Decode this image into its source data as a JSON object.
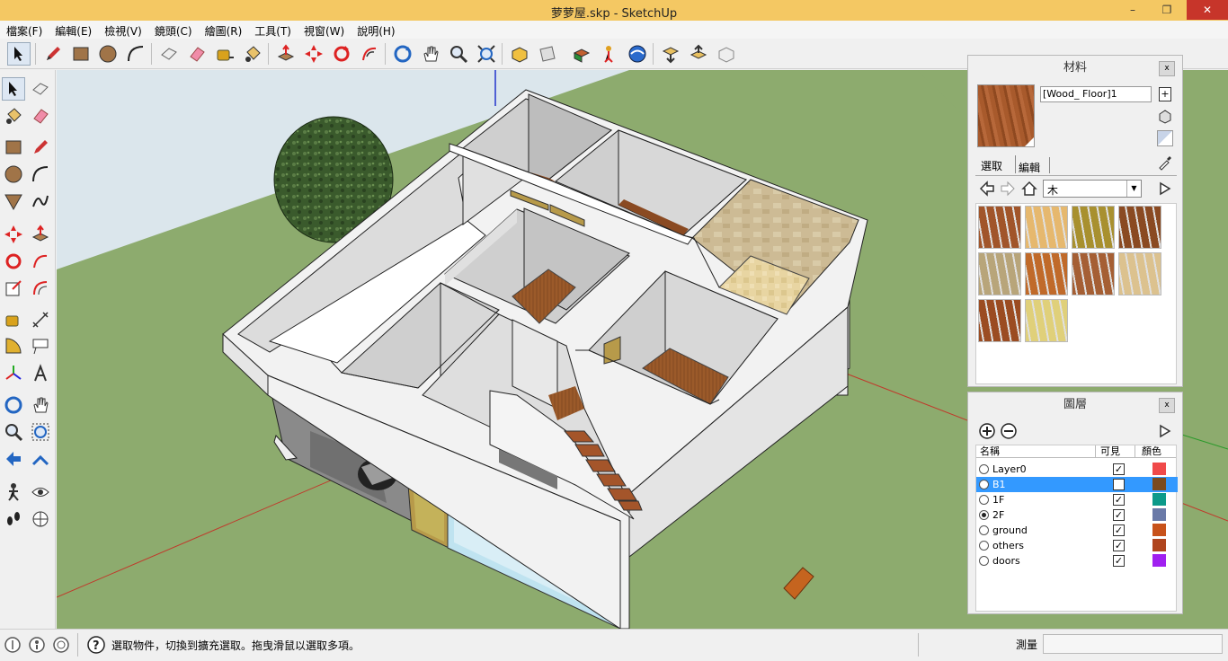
{
  "window": {
    "title": "萝萝屋.skp - SketchUp",
    "minimize": "–",
    "maximize": "❐",
    "close": "✕"
  },
  "menu": [
    "檔案(F)",
    "編輯(E)",
    "檢視(V)",
    "鏡頭(C)",
    "繪圖(R)",
    "工具(T)",
    "視窗(W)",
    "說明(H)"
  ],
  "materials": {
    "title": "材料",
    "close": "x",
    "name_value": "[Wood_ Floor]1",
    "tab_select": "選取",
    "tab_edit": "編輯",
    "collection": "木",
    "swatch_colors": [
      "#a1552a",
      "#e6b86e",
      "#a8902f",
      "#8a4a22",
      "#b8a57a",
      "#c06a2a",
      "#a55f34",
      "#dcc28f",
      "#9b4c22",
      "#e0d07a"
    ]
  },
  "layers": {
    "title": "圖層",
    "close": "x",
    "col_name": "名稱",
    "col_visible": "可見",
    "col_color": "顏色",
    "rows": [
      {
        "name": "Layer0",
        "visible": true,
        "active": false,
        "color": "#f04a4a"
      },
      {
        "name": "B1",
        "visible": false,
        "active": false,
        "color": "#7a4a1f",
        "selected": true
      },
      {
        "name": "1F",
        "visible": true,
        "active": false,
        "color": "#0c9a8a"
      },
      {
        "name": "2F",
        "visible": true,
        "active": true,
        "color": "#6a7aa8"
      },
      {
        "name": "ground",
        "visible": true,
        "active": false,
        "color": "#c8521a"
      },
      {
        "name": "others",
        "visible": true,
        "active": false,
        "color": "#b0451e"
      },
      {
        "name": "doors",
        "visible": true,
        "active": false,
        "color": "#a020f0"
      }
    ]
  },
  "status": {
    "hint": "選取物件，切換到擴充選取。拖曳滑鼠以選取多項。",
    "measure_label": "測量",
    "measure_value": ""
  },
  "colors": {
    "sky": "#dbe6ec",
    "ground": "#8dab6e",
    "wall": "#f2f2f2",
    "floor": "#9b5a2a",
    "accent": "#3399ff"
  }
}
